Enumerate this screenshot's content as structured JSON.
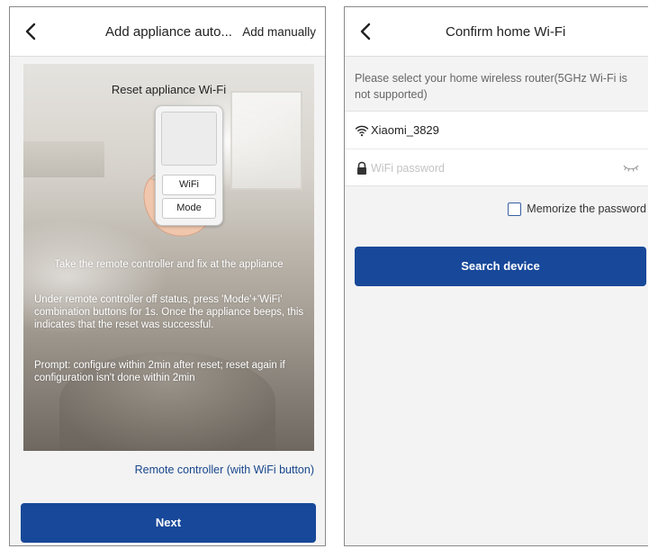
{
  "left_screen": {
    "header": {
      "title": "Add appliance auto...",
      "action": "Add manually"
    },
    "illustration": {
      "title": "Reset appliance Wi-Fi",
      "remote_buttons": [
        "WiFi",
        "Mode"
      ],
      "instruction_1": "Take the remote controller and fix at the appliance",
      "instruction_2": "Under remote controller off status, press 'Mode'+'WiFi' combination buttons for 1s. Once the appliance beeps, this indicates that the reset was successful.",
      "instruction_3": "Prompt: configure within 2min after reset; reset again if configuration isn't done within 2min"
    },
    "link": "Remote controller (with WiFi button)",
    "next_label": "Next"
  },
  "right_screen": {
    "header": {
      "title": "Confirm home Wi-Fi"
    },
    "hint": "Please select your home wireless router(5GHz Wi-Fi is not supported)",
    "ssid": "Xiaomi_3829",
    "password_placeholder": "WiFi password",
    "memorize_label": "Memorize the password",
    "memorize_checked": false,
    "search_label": "Search device"
  },
  "colors": {
    "primary": "#18489a",
    "link": "#17468c",
    "background": "#f3f3f3"
  },
  "icons": [
    "back-arrow-icon",
    "wifi-icon",
    "lock-icon",
    "eye-closed-icon",
    "checkbox-icon"
  ]
}
